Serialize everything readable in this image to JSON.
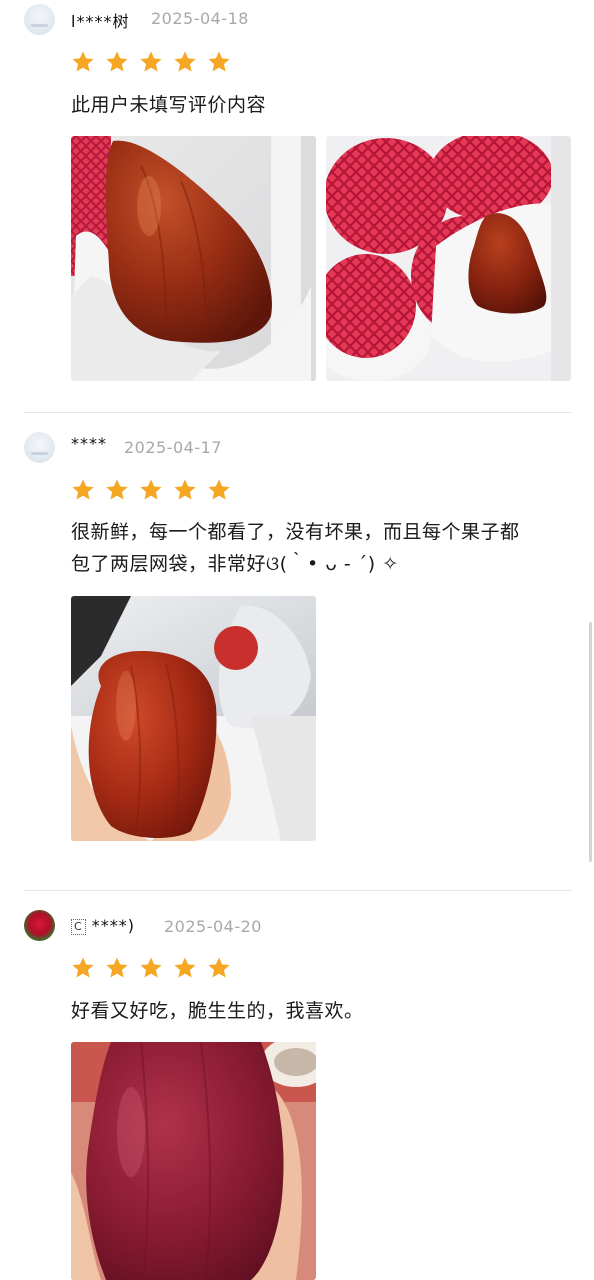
{
  "reviews": [
    {
      "username": "l****树",
      "date": "2025-04-18",
      "rating": 5,
      "text": "此用户未填写评价内容",
      "photos": [
        "fruit-in-gift-box-photo",
        "fruit-with-red-foam-nets-photo"
      ]
    },
    {
      "username": "****",
      "date": "2025-04-17",
      "rating": 5,
      "text_line1": "很新鲜，每一个都看了，没有坏果，而且每个果子都",
      "text_line2": "包了两层网袋，非常好ଓ(｀• ᴗ - ´) ✧",
      "photos": [
        "fruit-in-hand-photo"
      ]
    },
    {
      "username_box": "C",
      "username": "****)",
      "date": "2025-04-20",
      "rating": 5,
      "text": "好看又好吃，脆生生的，我喜欢。",
      "photos": [
        "fruit-closeup-photo"
      ]
    }
  ],
  "colors": {
    "star": "#f5a623",
    "divider": "#e6e6e6",
    "date": "#a8a8a8"
  }
}
